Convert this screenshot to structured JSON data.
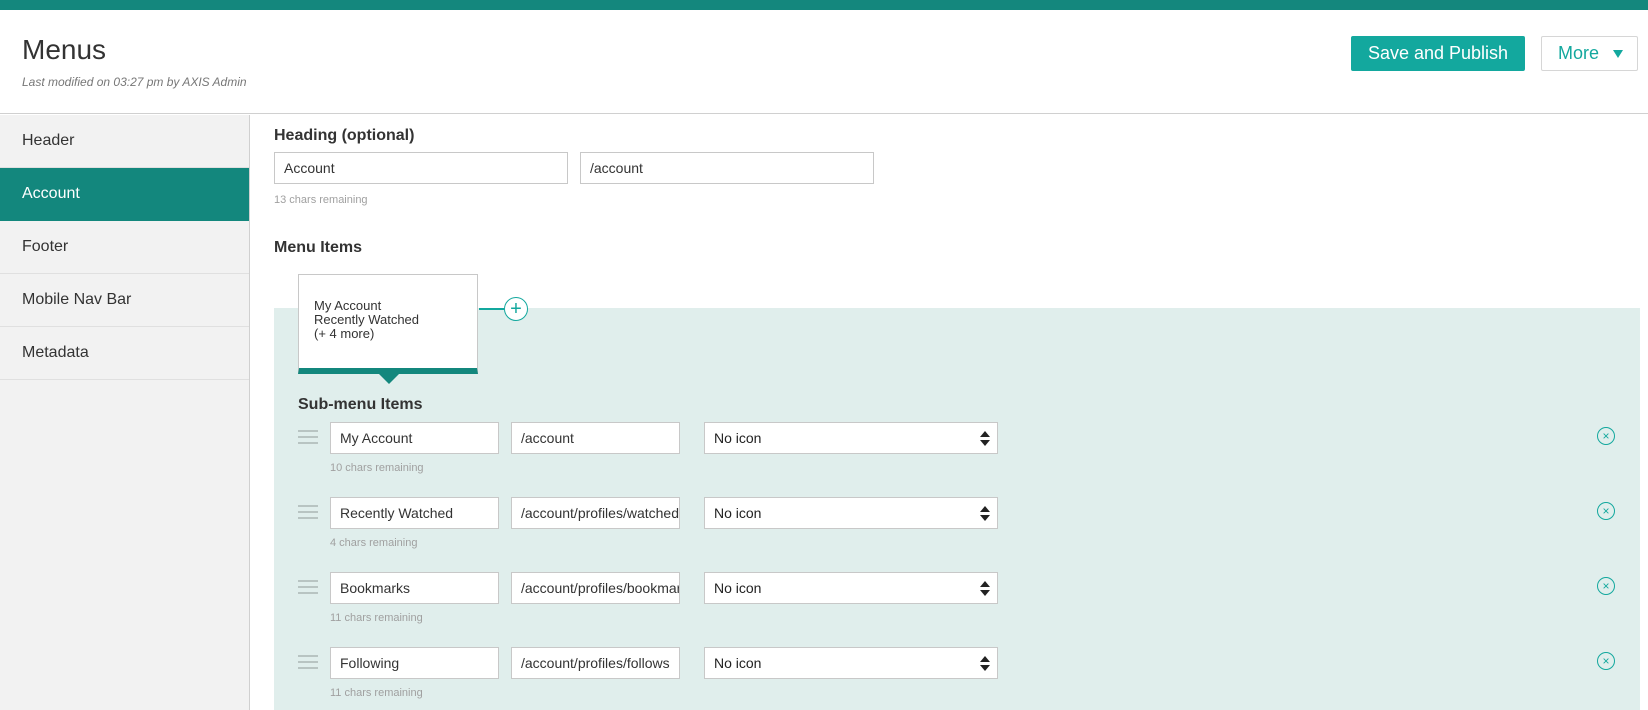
{
  "header": {
    "title": "Menus",
    "last_modified": "Last modified on 03:27 pm by AXIS Admin",
    "save_label": "Save and Publish",
    "more_label": "More"
  },
  "sidebar": {
    "items": [
      {
        "label": "Header"
      },
      {
        "label": "Account"
      },
      {
        "label": "Footer"
      },
      {
        "label": "Mobile Nav Bar"
      },
      {
        "label": "Metadata"
      }
    ]
  },
  "heading": {
    "label": "Heading (optional)",
    "title_value": "Account",
    "url_value": "/account",
    "hint": "13 chars remaining"
  },
  "menu_items": {
    "label": "Menu Items",
    "card_lines": [
      "My Account",
      "Recently Watched",
      "(+ 4 more)"
    ],
    "add_symbol": "+"
  },
  "submenu": {
    "label": "Sub-menu Items",
    "rows": [
      {
        "title": "My Account",
        "url": "/account",
        "icon": "No icon",
        "hint": "10 chars remaining"
      },
      {
        "title": "Recently Watched",
        "url": "/account/profiles/watched",
        "icon": "No icon",
        "hint": "4 chars remaining"
      },
      {
        "title": "Bookmarks",
        "url": "/account/profiles/bookmarks",
        "icon": "No icon",
        "hint": "11 chars remaining"
      },
      {
        "title": "Following",
        "url": "/account/profiles/follows",
        "icon": "No icon",
        "hint": "11 chars remaining"
      }
    ],
    "remove_symbol": "×"
  },
  "colors": {
    "accent": "#13a89e",
    "active_sidebar": "#13877d",
    "panel_bg": "#e0eeec"
  }
}
